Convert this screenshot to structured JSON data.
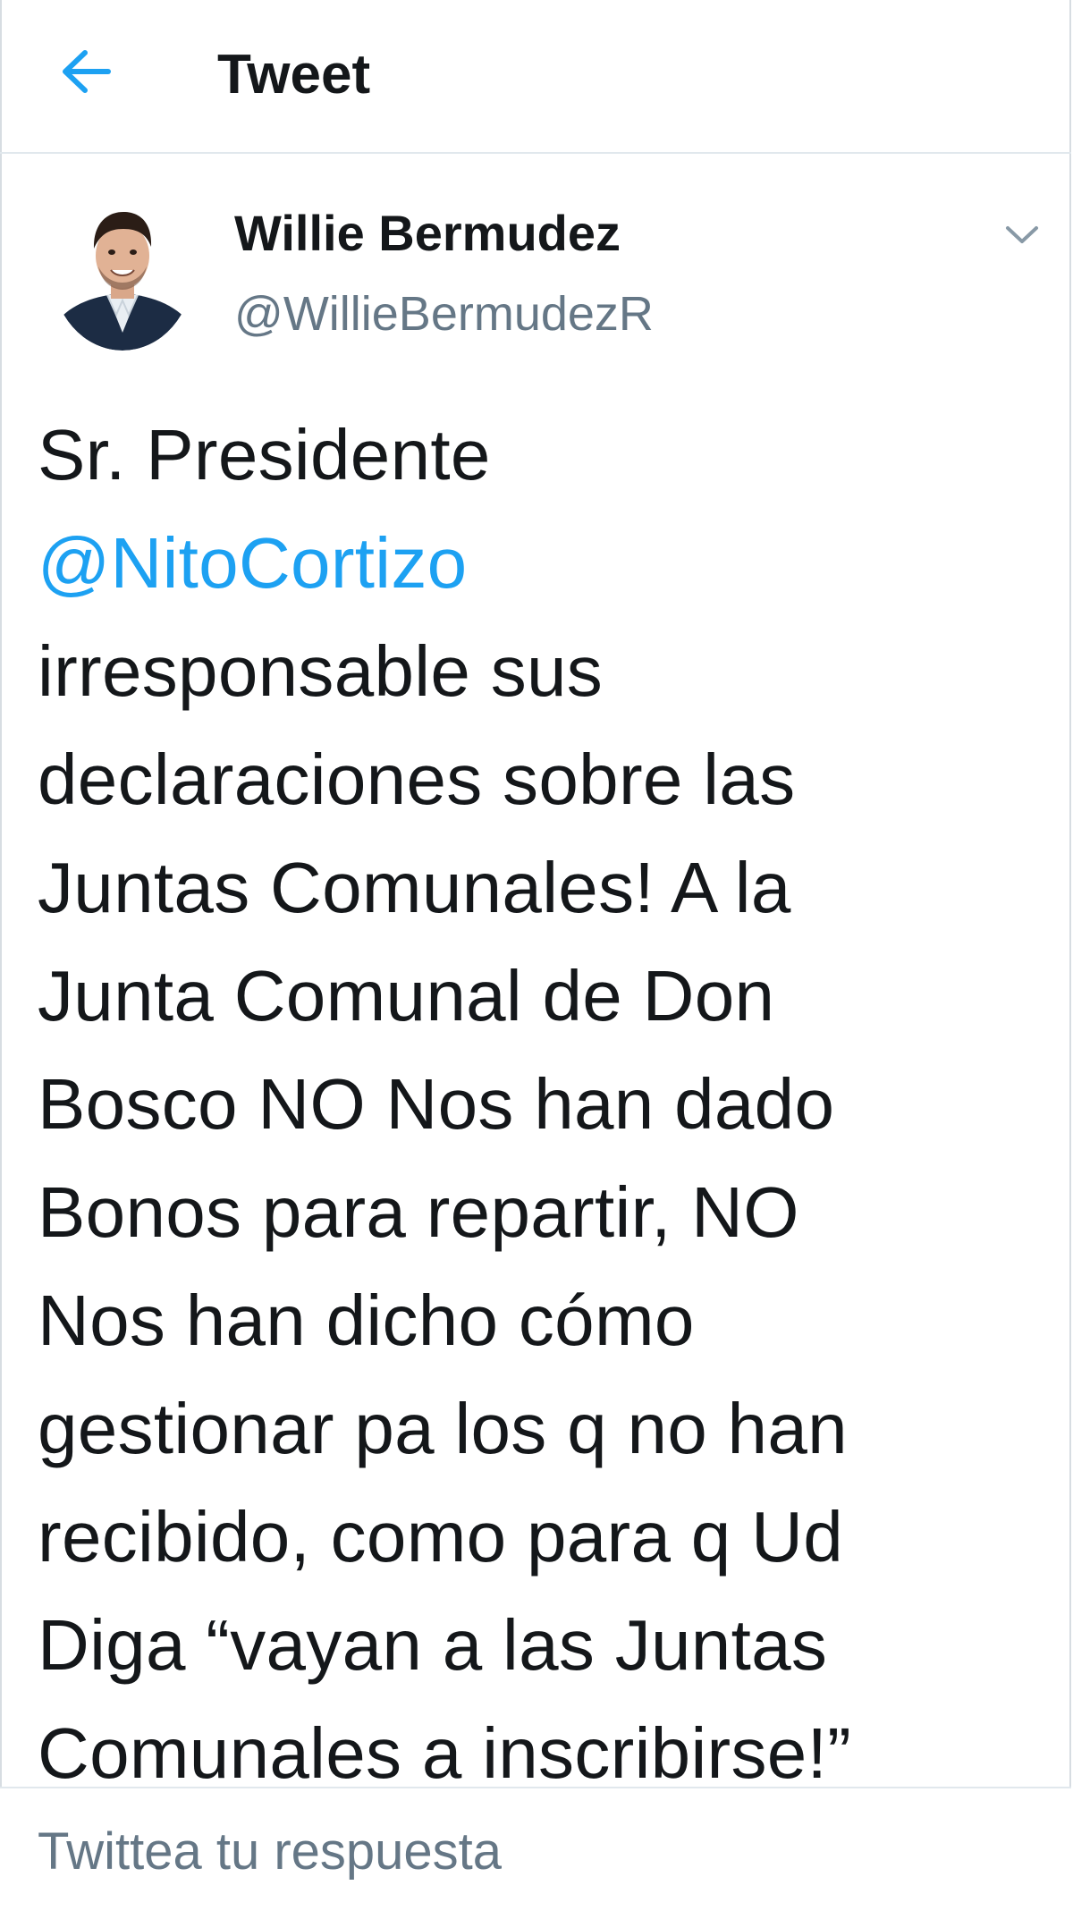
{
  "header": {
    "back_icon": "arrow-left-icon",
    "title": "Tweet"
  },
  "author": {
    "name": "Willie Bermudez",
    "handle": "@WillieBermudezR",
    "avatar_icon": "profile-photo",
    "menu_icon": "chevron-down-icon"
  },
  "tweet": {
    "lines": [
      {
        "text": "Sr. Presidente",
        "mention": false
      },
      {
        "text": "@NitoCortizo",
        "mention": true
      },
      {
        "text": "irresponsable sus",
        "mention": false
      },
      {
        "text": "declaraciones sobre las",
        "mention": false
      },
      {
        "text": "Juntas Comunales! A la",
        "mention": false
      },
      {
        "text": "Junta Comunal de Don",
        "mention": false
      },
      {
        "text": "Bosco NO Nos han dado",
        "mention": false
      },
      {
        "text": "Bonos para repartir, NO",
        "mention": false
      },
      {
        "text": "Nos han dicho cómo",
        "mention": false
      },
      {
        "text": "gestionar pa los q no han",
        "mention": false
      },
      {
        "text": "recibido, como para q Ud",
        "mention": false
      },
      {
        "text": "Diga “vayan a las Juntas",
        "mention": false
      },
      {
        "text": "Comunales a inscribirse!”",
        "mention": false
      }
    ]
  },
  "reply": {
    "placeholder": "Twittea tu respuesta",
    "value": ""
  },
  "colors": {
    "accent": "#1da1f2",
    "text": "#14171a",
    "secondary_text": "#657786",
    "divider": "#e1e8ed"
  }
}
